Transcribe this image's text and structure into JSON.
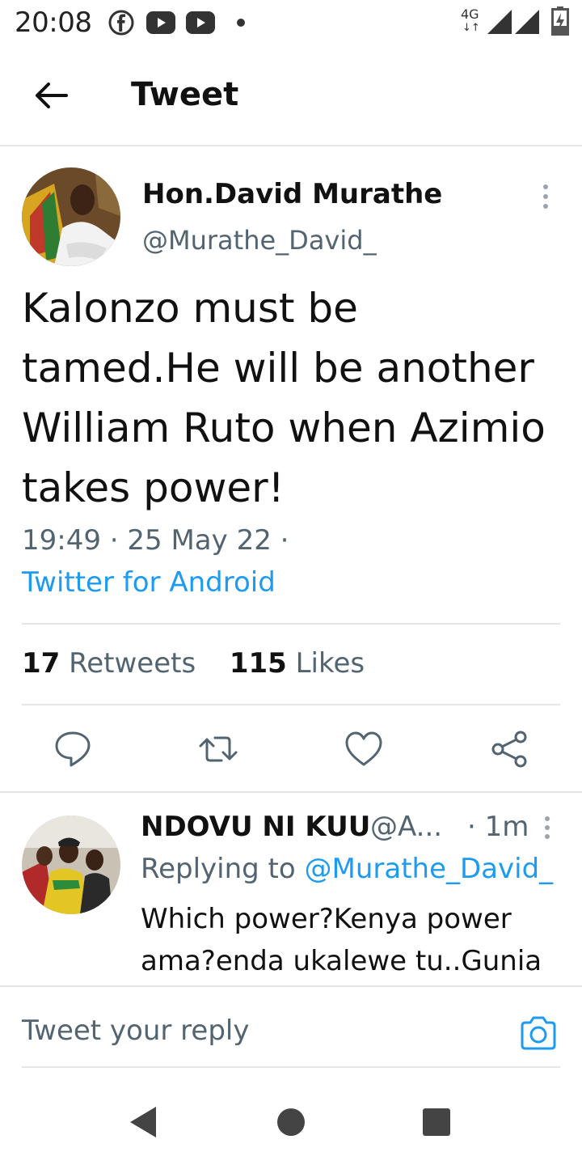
{
  "status_bar": {
    "time": "20:08",
    "network": "4G",
    "icons": [
      "facebook-icon",
      "youtube-icon",
      "youtube-icon",
      "dot-icon",
      "signal-icon",
      "signal-icon",
      "battery-charging-icon"
    ]
  },
  "header": {
    "title": "Tweet"
  },
  "tweet": {
    "author_name": "Hon.David Murathe",
    "author_handle": "@Murathe_David_",
    "text": "Kalonzo must be tamed.He will be another William Ruto when Azimio takes power!",
    "timestamp": "19:49 · 25 May 22 ·",
    "source": "Twitter for Android",
    "retweets_count": "17",
    "retweets_label": "Retweets",
    "likes_count": "115",
    "likes_label": "Likes"
  },
  "reply": {
    "author_name": "NDOVU NI KUU",
    "author_handle": "@A...",
    "time": "· 1m",
    "replying_prefix": "Replying to",
    "replying_mention": "@Murathe_David_",
    "text": "Which power?Kenya power ama?enda ukalewe tu..Gunia"
  },
  "composer": {
    "placeholder": "Tweet your reply"
  },
  "colors": {
    "accent": "#1d9bf0",
    "secondary_text": "#536471",
    "divider": "#e6e6e6"
  }
}
